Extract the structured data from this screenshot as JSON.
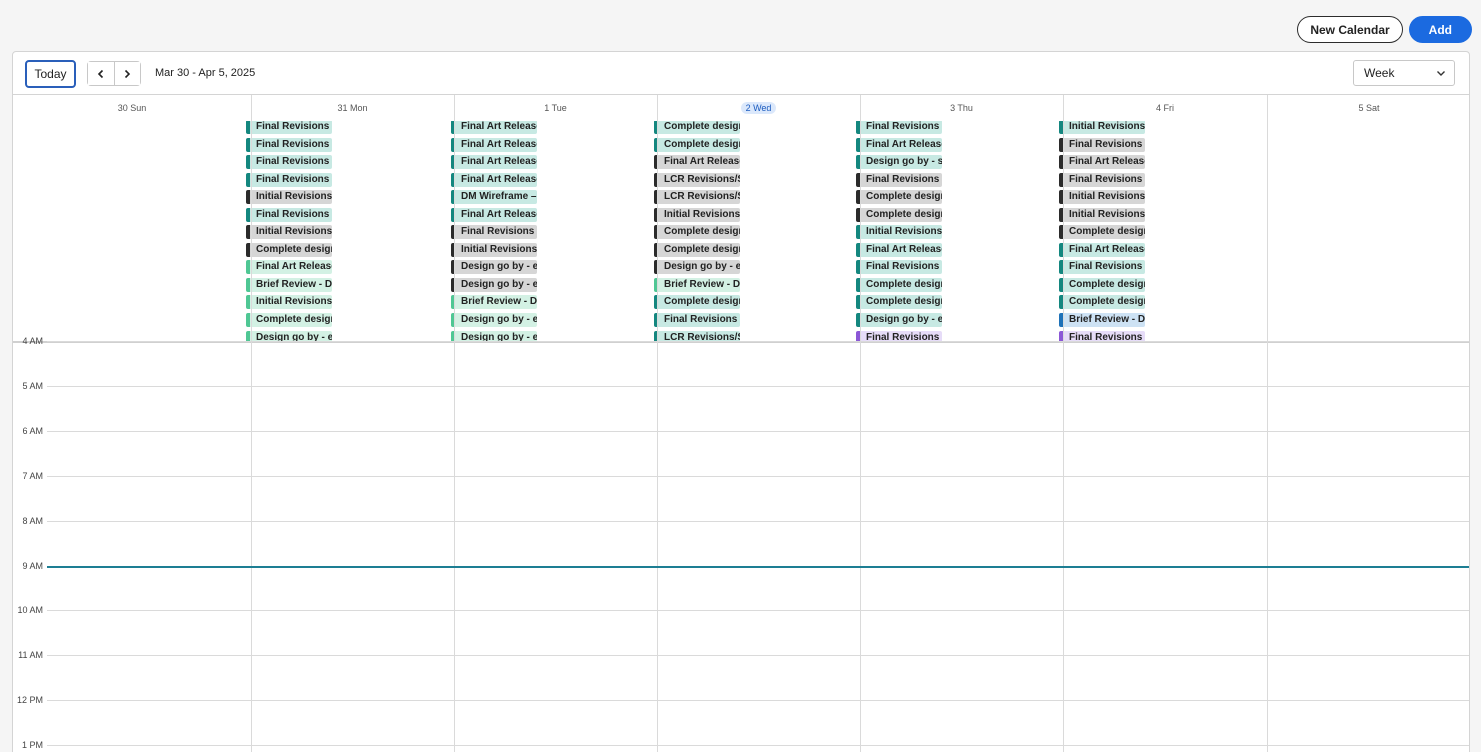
{
  "header": {
    "new_calendar_label": "New Calendar",
    "add_label": "Add"
  },
  "toolbar": {
    "today_label": "Today",
    "date_range": "Mar 30 - Apr 5, 2025",
    "view_value": "Week"
  },
  "days": [
    {
      "label": "30 Sun",
      "today": false,
      "events": []
    },
    {
      "label": "31 Mon",
      "today": false,
      "events": [
        {
          "title": "Final Revisions – ",
          "color": "teal"
        },
        {
          "title": "Final Revisions – ",
          "color": "teal"
        },
        {
          "title": "Final Revisions – ",
          "color": "teal"
        },
        {
          "title": "Final Revisions – ",
          "color": "teal"
        },
        {
          "title": "Initial Revisions",
          "color": "dark"
        },
        {
          "title": "Final Revisions – ",
          "color": "teal"
        },
        {
          "title": "Initial Revisions",
          "color": "dark"
        },
        {
          "title": "Complete design",
          "color": "dark"
        },
        {
          "title": "Final Art Release",
          "color": "mint"
        },
        {
          "title": "Brief Review - D",
          "color": "mint"
        },
        {
          "title": "Initial Revisions",
          "color": "mint"
        },
        {
          "title": "Complete design",
          "color": "mint"
        },
        {
          "title": "Design go by - e",
          "color": "mint"
        }
      ]
    },
    {
      "label": "1 Tue",
      "today": false,
      "events": [
        {
          "title": "Final Art Release",
          "color": "teal"
        },
        {
          "title": "Final Art Release",
          "color": "teal"
        },
        {
          "title": "Final Art Release",
          "color": "teal"
        },
        {
          "title": "Final Art Release",
          "color": "teal"
        },
        {
          "title": "DM Wireframe – ",
          "color": "teal"
        },
        {
          "title": "Final Art Release",
          "color": "teal"
        },
        {
          "title": "Final Revisions –",
          "color": "dark"
        },
        {
          "title": "Initial Revisions –",
          "color": "dark"
        },
        {
          "title": "Design go by - en",
          "color": "dark"
        },
        {
          "title": "Design go by - en",
          "color": "dark"
        },
        {
          "title": "Brief Review - De",
          "color": "mint"
        },
        {
          "title": "Design go by - en",
          "color": "mint"
        },
        {
          "title": "Design go by - en",
          "color": "mint"
        }
      ]
    },
    {
      "label": "2 Wed",
      "today": true,
      "events": [
        {
          "title": "Complete design",
          "color": "teal"
        },
        {
          "title": "Complete design",
          "color": "teal"
        },
        {
          "title": "Final Art Release",
          "color": "dark"
        },
        {
          "title": "LCR Revisions/S",
          "color": "dark"
        },
        {
          "title": "LCR Revisions/S",
          "color": "dark"
        },
        {
          "title": "Initial Revisions",
          "color": "dark"
        },
        {
          "title": "Complete design",
          "color": "dark"
        },
        {
          "title": "Complete design",
          "color": "dark"
        },
        {
          "title": "Design go by - e",
          "color": "dark"
        },
        {
          "title": "Brief Review - De",
          "color": "mint"
        },
        {
          "title": "Complete design",
          "color": "teal"
        },
        {
          "title": "Final Revisions –",
          "color": "teal"
        },
        {
          "title": "LCR Revisions/S",
          "color": "teal"
        }
      ]
    },
    {
      "label": "3 Thu",
      "today": false,
      "events": [
        {
          "title": "Final Revisions –",
          "color": "teal"
        },
        {
          "title": "Final Art Release",
          "color": "teal"
        },
        {
          "title": "Design go by - sg",
          "color": "teal"
        },
        {
          "title": "Final Revisions –",
          "color": "dark"
        },
        {
          "title": "Complete design",
          "color": "dark"
        },
        {
          "title": "Complete design",
          "color": "dark"
        },
        {
          "title": "Initial Revisions",
          "color": "teal"
        },
        {
          "title": "Final Art Release",
          "color": "teal"
        },
        {
          "title": "Final Revisions –",
          "color": "teal"
        },
        {
          "title": "Complete design",
          "color": "teal"
        },
        {
          "title": "Complete design",
          "color": "teal"
        },
        {
          "title": "Design go by - en",
          "color": "teal"
        },
        {
          "title": "Final Revisions –",
          "color": "purple"
        }
      ]
    },
    {
      "label": "4 Fri",
      "today": false,
      "events": [
        {
          "title": "Initial Revisions –",
          "color": "teal"
        },
        {
          "title": "Final Revisions –",
          "color": "dark"
        },
        {
          "title": "Final Art Release",
          "color": "dark"
        },
        {
          "title": "Final Revisions –",
          "color": "dark"
        },
        {
          "title": "Initial Revisions",
          "color": "dark"
        },
        {
          "title": "Initial Revisions –",
          "color": "dark"
        },
        {
          "title": "Complete design",
          "color": "dark"
        },
        {
          "title": "Final Art Release",
          "color": "teal"
        },
        {
          "title": "Final Revisions –",
          "color": "teal"
        },
        {
          "title": "Complete design",
          "color": "teal"
        },
        {
          "title": "Complete design",
          "color": "teal"
        },
        {
          "title": "Brief Review - De",
          "color": "blue"
        },
        {
          "title": "Final Revisions –",
          "color": "purple"
        }
      ]
    },
    {
      "label": "5 Sat",
      "today": false,
      "events": []
    }
  ],
  "hours": [
    "4 AM",
    "5 AM",
    "6 AM",
    "7 AM",
    "8 AM",
    "9 AM",
    "10 AM",
    "11 AM",
    "12 PM",
    "1 PM"
  ],
  "colors": {
    "accent": "#1b6ae0",
    "teal": "#14877f",
    "dark": "#2b2b2b",
    "mint": "#4fc794",
    "blue": "#1e72b8",
    "purple": "#8b57d6",
    "now_line": "#1d7e93"
  }
}
